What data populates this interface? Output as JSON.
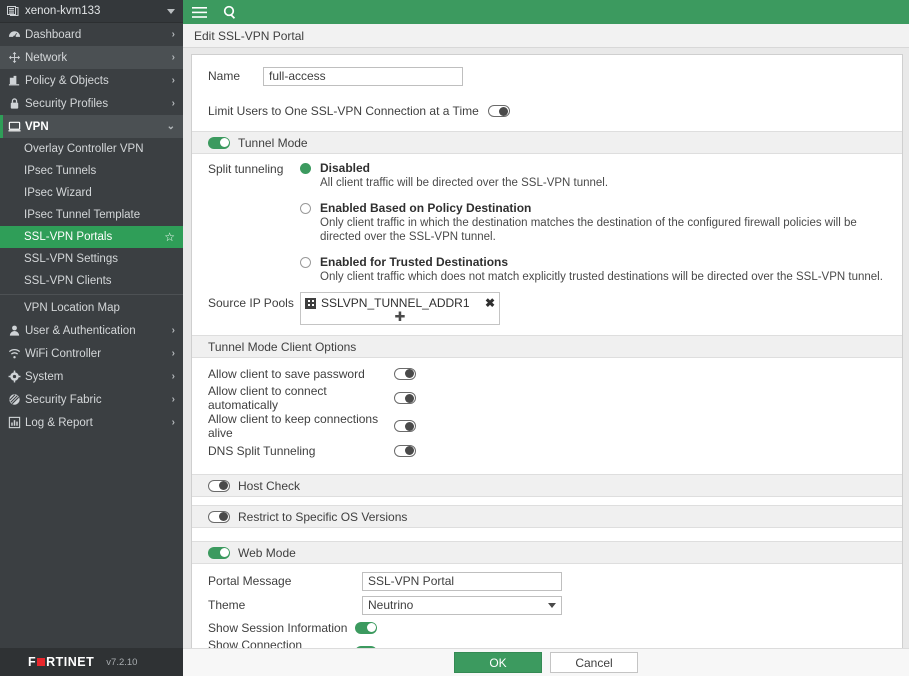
{
  "sidebar": {
    "host": {
      "name": "xenon-kvm133",
      "icon": "server-icon",
      "caret": "chevron-down-icon"
    },
    "items": [
      {
        "label": "Dashboard",
        "icon": "dashboard-icon",
        "state": "collapsed"
      },
      {
        "label": "Network",
        "icon": "network-icon",
        "state": "hovered"
      },
      {
        "label": "Policy & Objects",
        "icon": "policy-icon",
        "state": "collapsed"
      },
      {
        "label": "Security Profiles",
        "icon": "lock-icon",
        "state": "collapsed"
      },
      {
        "label": "VPN",
        "icon": "monitor-icon",
        "state": "expanded"
      }
    ],
    "vpn_children": [
      {
        "label": "Overlay Controller VPN",
        "active": false
      },
      {
        "label": "IPsec Tunnels",
        "active": false
      },
      {
        "label": "IPsec Wizard",
        "active": false
      },
      {
        "label": "IPsec Tunnel Template",
        "active": false
      },
      {
        "label": "SSL-VPN Portals",
        "active": true,
        "star": "☆"
      },
      {
        "label": "SSL-VPN Settings",
        "active": false
      },
      {
        "label": "SSL-VPN Clients",
        "active": false
      },
      {
        "label": "VPN Location Map",
        "active": false,
        "separator_before": true
      }
    ],
    "items_bottom": [
      {
        "label": "User & Authentication",
        "icon": "user-icon"
      },
      {
        "label": "WiFi Controller",
        "icon": "wifi-icon"
      },
      {
        "label": "System",
        "icon": "gear-icon"
      },
      {
        "label": "Security Fabric",
        "icon": "fabric-icon"
      },
      {
        "label": "Log & Report",
        "icon": "chart-icon"
      }
    ],
    "chevron": "›"
  },
  "topbar": {
    "menu_icon": "hamburger-menu-icon",
    "search_icon": "search-icon"
  },
  "breadcrumb": {
    "title": "Edit SSL-VPN Portal"
  },
  "form": {
    "name": {
      "label": "Name",
      "value": "full-access"
    },
    "limit_users": {
      "label": "Limit Users to One SSL-VPN Connection at a Time",
      "state": "off"
    },
    "tunnel_mode": {
      "section_label": "Tunnel Mode",
      "state": "on",
      "split_tunneling": {
        "label": "Split tunneling",
        "options": [
          {
            "title": "Disabled",
            "desc": "All client traffic will be directed over the SSL-VPN tunnel.",
            "selected": true
          },
          {
            "title": "Enabled Based on Policy Destination",
            "desc": "Only client traffic in which the destination matches the destination of the configured firewall policies will be directed over the SSL-VPN tunnel.",
            "selected": false
          },
          {
            "title": "Enabled for Trusted Destinations",
            "desc": "Only client traffic which does not match explicitly trusted destinations will be directed over the SSL-VPN tunnel.",
            "selected": false
          }
        ]
      },
      "source_ip_pools": {
        "label": "Source IP Pools",
        "tags": [
          {
            "name": "SSLVPN_TUNNEL_ADDR1",
            "icon": "address-object-icon",
            "remove": "✖"
          }
        ],
        "add": "✚"
      }
    },
    "client_options": {
      "section_label": "Tunnel Mode Client Options",
      "rows": [
        {
          "label": "Allow client to save password",
          "state": "off"
        },
        {
          "label": "Allow client to connect automatically",
          "state": "off"
        },
        {
          "label": "Allow client to keep connections alive",
          "state": "off"
        },
        {
          "label": "DNS Split Tunneling",
          "state": "off"
        }
      ]
    },
    "host_check": {
      "section_label": "Host Check",
      "state": "off"
    },
    "restrict_os": {
      "section_label": "Restrict to Specific OS Versions",
      "state": "off"
    },
    "web_mode": {
      "section_label": "Web Mode",
      "state": "on",
      "portal_message": {
        "label": "Portal Message",
        "value": "SSL-VPN Portal"
      },
      "theme": {
        "label": "Theme",
        "value": "Neutrino"
      },
      "show_session_information": {
        "label": "Show Session Information",
        "state": "on"
      },
      "show_connection_launcher": {
        "label": "Show Connection Launcher",
        "state": "on"
      }
    }
  },
  "footer": {
    "brand_pre": "F",
    "brand_post": "RTINET",
    "version": "v7.2.10",
    "ok_label": "OK",
    "cancel_label": "Cancel"
  },
  "colors": {
    "accent_green": "#3c9a5f",
    "sidebar_bg": "#3b3f42",
    "brand_red": "#e8272c"
  }
}
